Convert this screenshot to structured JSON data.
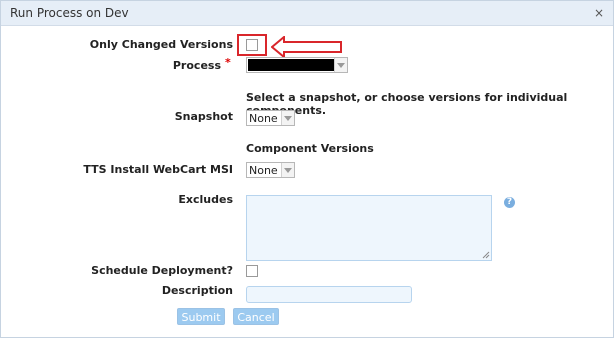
{
  "dialog": {
    "title": "Run Process on Dev",
    "close_glyph": "×"
  },
  "form": {
    "only_changed_label": "Only Changed Versions",
    "process_label": "Process",
    "process_required_mark": "*",
    "process_value": "",
    "snapshot_hint": "Select a snapshot, or choose versions for individual components.",
    "snapshot_label": "Snapshot",
    "snapshot_value": "None",
    "component_versions_heading": "Component Versions",
    "tts_label": "TTS Install WebCart MSI",
    "tts_value": "None",
    "excludes_label": "Excludes",
    "excludes_value": "",
    "schedule_label": "Schedule Deployment?",
    "description_label": "Description",
    "description_value": "",
    "help_glyph": "?"
  },
  "buttons": {
    "submit_label": "Submit",
    "cancel_label": "Cancel"
  },
  "annotation": {
    "highlight_color": "#d9262b"
  },
  "colors": {
    "titlebar_bg": "#e6eef7",
    "button_bg": "#9ccaf0",
    "required": "#dd0000",
    "redacted": "#000000"
  }
}
